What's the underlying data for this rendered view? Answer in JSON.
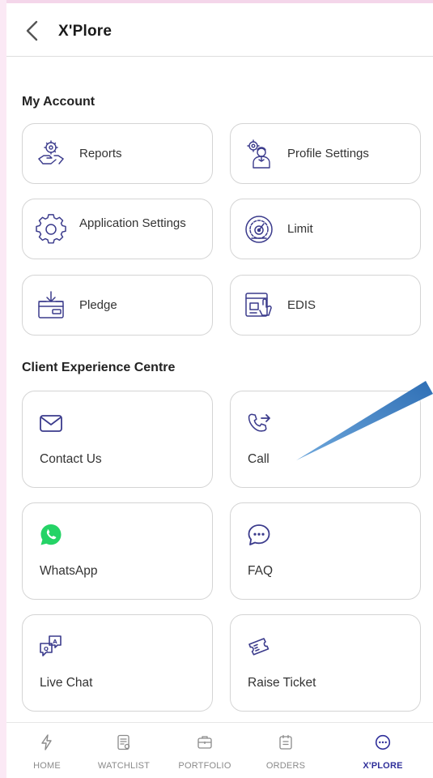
{
  "header": {
    "title": "X'Plore"
  },
  "my_account": {
    "title": "My Account",
    "items": [
      {
        "label": "Reports",
        "icon": "reports-icon"
      },
      {
        "label": "Profile Settings",
        "icon": "profile-settings-icon"
      },
      {
        "label": "Application Settings",
        "icon": "gear-icon"
      },
      {
        "label": "Limit",
        "icon": "limit-gauge-icon"
      },
      {
        "label": "Pledge",
        "icon": "pledge-icon"
      },
      {
        "label": "EDIS",
        "icon": "edis-icon"
      }
    ]
  },
  "client_experience": {
    "title": "Client Experience Centre",
    "items": [
      {
        "label": "Contact Us",
        "icon": "mail-icon"
      },
      {
        "label": "Call",
        "icon": "phone-icon"
      },
      {
        "label": "WhatsApp",
        "icon": "whatsapp-icon"
      },
      {
        "label": "FAQ",
        "icon": "chat-bubble-icon"
      },
      {
        "label": "Live Chat",
        "icon": "live-chat-icon"
      },
      {
        "label": "Raise Ticket",
        "icon": "ticket-icon"
      }
    ]
  },
  "bottom_nav": {
    "items": [
      {
        "label": "HOME",
        "icon": "lightning-icon"
      },
      {
        "label": "WATCHLIST",
        "icon": "watchlist-icon"
      },
      {
        "label": "PORTFOLIO",
        "icon": "briefcase-icon"
      },
      {
        "label": "ORDERS",
        "icon": "orders-icon"
      },
      {
        "label": "X'PLORE",
        "icon": "more-icon",
        "active": true
      }
    ]
  },
  "colors": {
    "accent": "#2f2f9a",
    "whatsapp": "#25d366",
    "card_border": "#d4d4d4",
    "annotation_arrow": "#5b9bd5"
  }
}
